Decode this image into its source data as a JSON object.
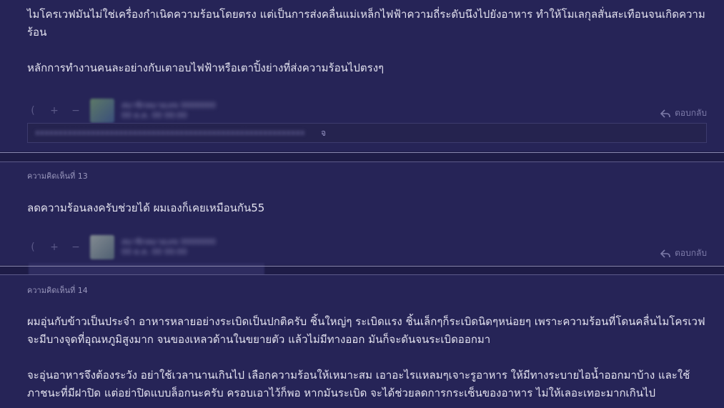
{
  "comment_prev": {
    "text_line1": "ไมโครเวฟมันไม่ใช่เครื่องกำเนิดความร้อนโดยตรง แต่เป็นการส่งคลื่นแม่เหล็กไฟฟ้าความถี่ระดับนึงไปยังอาหาร ทำให้โมเลกุลสั่นสะเทือนจนเกิดความ",
    "text_line2": "ร้อน",
    "text_line3": "หลักการทำงานคนละอย่างกับเตาอบไฟฟ้าหรือเตาปิ้งย่างที่ส่งความร้อนไปตรงๆ",
    "reply_label": "ตอบกลับ",
    "reply_box_tail": "จ"
  },
  "comment_13": {
    "label": "ความคิดเห็นที่ 13",
    "text": "ลดความร้อนลงครับช่วยได้ ผมเองก็เคยเหมือนกัน55",
    "reply_label": "ตอบกลับ"
  },
  "comment_14": {
    "label": "ความคิดเห็นที่ 14",
    "para1_line1": "ผมอุ่นกับข้าวเป็นประจำ อาหารหลายอย่างระเบิดเป็นปกติครับ  ชิ้นใหญ่ๆ ระเบิดแรง ชิ้นเล็กๆก็ระเบิดนิดๆหน่อยๆ เพราะความร้อนที่โดนคลื่นไมโครเวฟ",
    "para1_line2": "จะมีบางจุดที่อุณหภูมิสูงมาก จนของเหลวด้านในขยายตัว แล้วไม่มีทางออก มันก็จะดันจนระเบิดออกมา",
    "para2_line1": "จะอุ่นอาหารจึงต้องระวัง อย่าใช้เวลานานเกินไป เลือกความร้อนให้เหมาะสม เอาอะไรแหลมๆเจาะรูอาหาร ให้มีทางระบายไอน้ำออกมาบ้าง และใช้",
    "para2_line2": "ภาชนะที่มีฝาปิด แต่อย่าปิดแบบล็อกนะครับ ครอบเอาไว้ก็พอ หากมันระเบิด จะได้ช่วยลดการกระเซ็นของอาหาร ไม่ให้เลอะเทอะมากเกินไป"
  },
  "icons": [
    "emoji-icon",
    "plus-icon",
    "minus-icon",
    "reply-icon"
  ],
  "colors": {
    "background": "#1e1c47",
    "card": "#262457",
    "divider": "#8a88b0"
  }
}
